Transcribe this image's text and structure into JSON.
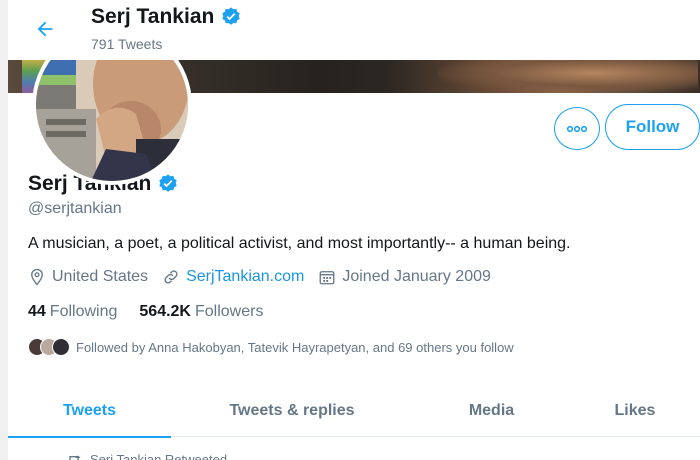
{
  "header": {
    "name": "Serj Tankian",
    "tweet_count": "791 Tweets"
  },
  "profile": {
    "display_name": "Serj Tankian",
    "handle": "@serjtankian",
    "bio": "A musician, a poet, a political activist, and most importantly-- a human being.",
    "location": "United States",
    "website": "SerjTankian.com",
    "joined": "Joined January 2009",
    "following_count": "44",
    "following_label": "Following",
    "followers_count": "564.2K",
    "followers_label": "Followers",
    "followed_by": "Followed by Anna Hakobyan, Tatevik Hayrapetyan, and 69 others you follow"
  },
  "actions": {
    "follow_label": "Follow",
    "more_icon": "more-icon"
  },
  "tabs": [
    {
      "label": "Tweets",
      "active": true
    },
    {
      "label": "Tweets & replies",
      "active": false
    },
    {
      "label": "Media",
      "active": false
    },
    {
      "label": "Likes",
      "active": false
    }
  ],
  "timeline": {
    "retweet_label": "Serj Tankian Retweeted"
  },
  "colors": {
    "accent": "#1da1f2",
    "link": "#1b95e0",
    "secondary_text": "#657786",
    "primary_text": "#14171a"
  }
}
